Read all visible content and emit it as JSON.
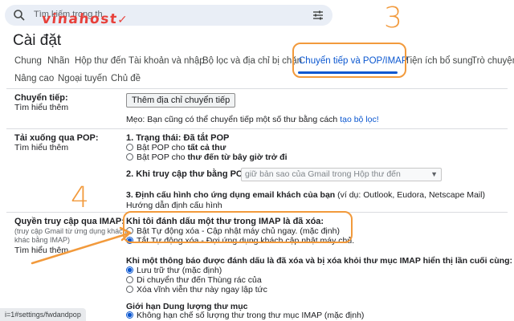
{
  "search": {
    "placeholder": "Tìm kiếm trong th"
  },
  "logo": {
    "text": "vinahost",
    "tick": "✓"
  },
  "page_title": "Cài đặt",
  "tabs": [
    "Chung",
    "Nhãn",
    "Hộp thư đến",
    "Tài khoản và nhập",
    "Bộ lọc và địa chỉ bị chặn",
    "Chuyển tiếp và POP/IMAP",
    "Tiện ích bổ sung",
    "Trò chuyện"
  ],
  "tabs_row2": [
    "Nâng cao",
    "Ngoại tuyến",
    "Chủ đề"
  ],
  "forwarding": {
    "label": "Chuyển tiếp:",
    "learn_more": "Tìm hiểu thêm",
    "add_button": "Thêm địa chỉ chuyển tiếp",
    "tip_prefix": "Mẹo: Bạn cũng có thể chuyển tiếp một số thư bằng cách ",
    "tip_link": "tạo bộ lọc!"
  },
  "pop": {
    "label": "Tải xuống qua POP:",
    "learn_more": "Tìm hiểu thêm",
    "status_heading": "1. Trạng thái: Đã tắt POP",
    "opt1_prefix": "Bật POP cho ",
    "opt1_bold": "tất cả thư",
    "opt2_prefix": "Bật POP cho ",
    "opt2_bold": "thư đến từ bây giờ trở đi",
    "when_access_heading": "2. Khi truy cập thư bằng POP",
    "when_access_select": "giữ bản sao của Gmail trong Hộp thư đến",
    "config_heading": "3. Định cấu hình cho ứng dụng email khách của bạn",
    "config_hint": " (ví dụ: Outlook, Eudora, Netscape Mail)",
    "config_link": "Hướng dẫn định cấu hình"
  },
  "imap": {
    "label": "Quyền truy cập qua IMAP:",
    "sub1": "(truy cập Gmail từ ứng dụng khách",
    "sub2": "khác bằng IMAP)",
    "learn_more": "Tìm hiểu thêm",
    "delete_heading": "Khi tôi đánh dấu một thư trong IMAP là đã xóa:",
    "delete_opt1": "Bật Tự động xóa - Cập nhật máy chủ ngay. (mặc định)",
    "delete_opt2": "Tắt Tự động xóa - Đợi ứng dụng khách cập nhật máy chủ.",
    "expunge_heading": "Khi một thông báo được đánh dấu là đã xóa và bị xóa khỏi thư mục IMAP hiển thị lần cuối cùng:",
    "expunge_opt1": "Lưu trữ thư (mặc định)",
    "expunge_opt2": "Di chuyển thư đến Thùng rác của",
    "expunge_opt3": "Xóa vĩnh viễn thư này ngay lập tức",
    "limit_heading": "Giới hạn Dung lượng thư mục",
    "limit_opt1": "Không hạn chế số lượng thư trong thư mục IMAP (mặc định)"
  },
  "annotations": {
    "step3": "3",
    "step4": "4",
    "accent_color": "#f29a3c"
  },
  "status_url": "i=1#settings/fwdandpop"
}
